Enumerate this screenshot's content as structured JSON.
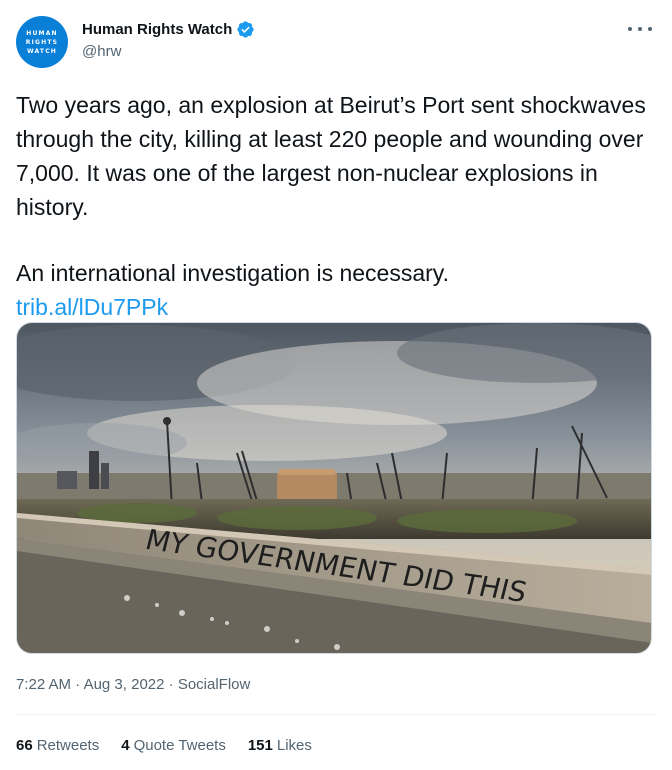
{
  "author": {
    "avatar_lines": [
      "HUMAN",
      "RIGHTS",
      "WATCH"
    ],
    "display_name": "Human Rights Watch",
    "handle": "@hrw",
    "verified": true
  },
  "tweet": {
    "paragraph1": "Two years ago, an explosion at Beirut’s Port sent shockwaves through the city, killing at least 220 people and wounding over 7,000. It was one of the largest non-nuclear explosions in history.",
    "paragraph2": "An international investigation is necessary.",
    "link": "trib.al/lDu7PPk",
    "image_text": "MY GOVERNMENT DID THIS"
  },
  "meta": {
    "time": "7:22 AM",
    "date": "Aug 3, 2022",
    "source": "SocialFlow",
    "separator": "·"
  },
  "stats": {
    "retweets_count": "66",
    "retweets_label": "Retweets",
    "quotes_count": "4",
    "quotes_label": "Quote Tweets",
    "likes_count": "151",
    "likes_label": "Likes"
  },
  "colors": {
    "accent": "#1d9bf0",
    "avatar": "#0a7fd8",
    "secondary_text": "#536471"
  }
}
